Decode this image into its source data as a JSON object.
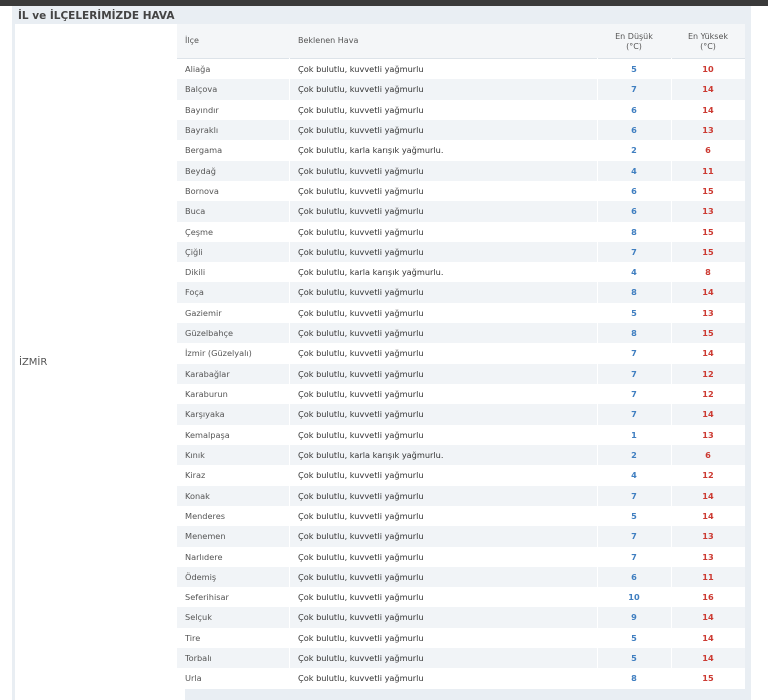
{
  "section": {
    "title": "İL ve İLÇELERİMİZDE HAVA",
    "province": "İZMİR"
  },
  "table": {
    "headers": {
      "district": "İlçe",
      "weather": "Beklenen Hava",
      "min": "En Düşük",
      "min_unit": "(°C)",
      "max": "En Yüksek",
      "max_unit": "(°C)"
    },
    "rows": [
      {
        "district": "Aliağa",
        "weather": "Çok bulutlu, kuvvetli yağmurlu",
        "min": "5",
        "max": "10"
      },
      {
        "district": "Balçova",
        "weather": "Çok bulutlu, kuvvetli yağmurlu",
        "min": "7",
        "max": "14"
      },
      {
        "district": "Bayındır",
        "weather": "Çok bulutlu, kuvvetli yağmurlu",
        "min": "6",
        "max": "14"
      },
      {
        "district": "Bayraklı",
        "weather": "Çok bulutlu, kuvvetli yağmurlu",
        "min": "6",
        "max": "13"
      },
      {
        "district": "Bergama",
        "weather": "Çok bulutlu, karla karışık yağmurlu.",
        "min": "2",
        "max": "6"
      },
      {
        "district": "Beydağ",
        "weather": "Çok bulutlu, kuvvetli yağmurlu",
        "min": "4",
        "max": "11"
      },
      {
        "district": "Bornova",
        "weather": "Çok bulutlu, kuvvetli yağmurlu",
        "min": "6",
        "max": "15"
      },
      {
        "district": "Buca",
        "weather": "Çok bulutlu, kuvvetli yağmurlu",
        "min": "6",
        "max": "13"
      },
      {
        "district": "Çeşme",
        "weather": "Çok bulutlu, kuvvetli yağmurlu",
        "min": "8",
        "max": "15"
      },
      {
        "district": "Çiğli",
        "weather": "Çok bulutlu, kuvvetli yağmurlu",
        "min": "7",
        "max": "15"
      },
      {
        "district": "Dikili",
        "weather": "Çok bulutlu, karla karışık yağmurlu.",
        "min": "4",
        "max": "8"
      },
      {
        "district": "Foça",
        "weather": "Çok bulutlu, kuvvetli yağmurlu",
        "min": "8",
        "max": "14"
      },
      {
        "district": "Gaziemir",
        "weather": "Çok bulutlu, kuvvetli yağmurlu",
        "min": "5",
        "max": "13"
      },
      {
        "district": "Güzelbahçe",
        "weather": "Çok bulutlu, kuvvetli yağmurlu",
        "min": "8",
        "max": "15"
      },
      {
        "district": "İzmir (Güzelyalı)",
        "weather": "Çok bulutlu, kuvvetli yağmurlu",
        "min": "7",
        "max": "14"
      },
      {
        "district": "Karabağlar",
        "weather": "Çok bulutlu, kuvvetli yağmurlu",
        "min": "7",
        "max": "12"
      },
      {
        "district": "Karaburun",
        "weather": "Çok bulutlu, kuvvetli yağmurlu",
        "min": "7",
        "max": "12"
      },
      {
        "district": "Karşıyaka",
        "weather": "Çok bulutlu, kuvvetli yağmurlu",
        "min": "7",
        "max": "14"
      },
      {
        "district": "Kemalpaşa",
        "weather": "Çok bulutlu, kuvvetli yağmurlu",
        "min": "1",
        "max": "13"
      },
      {
        "district": "Kınık",
        "weather": "Çok bulutlu, karla karışık yağmurlu.",
        "min": "2",
        "max": "6"
      },
      {
        "district": "Kiraz",
        "weather": "Çok bulutlu, kuvvetli yağmurlu",
        "min": "4",
        "max": "12"
      },
      {
        "district": "Konak",
        "weather": "Çok bulutlu, kuvvetli yağmurlu",
        "min": "7",
        "max": "14"
      },
      {
        "district": "Menderes",
        "weather": "Çok bulutlu, kuvvetli yağmurlu",
        "min": "5",
        "max": "14"
      },
      {
        "district": "Menemen",
        "weather": "Çok bulutlu, kuvvetli yağmurlu",
        "min": "7",
        "max": "13"
      },
      {
        "district": "Narlıdere",
        "weather": "Çok bulutlu, kuvvetli yağmurlu",
        "min": "7",
        "max": "13"
      },
      {
        "district": "Ödemiş",
        "weather": "Çok bulutlu, kuvvetli yağmurlu",
        "min": "6",
        "max": "11"
      },
      {
        "district": "Seferihisar",
        "weather": "Çok bulutlu, kuvvetli yağmurlu",
        "min": "10",
        "max": "16"
      },
      {
        "district": "Selçuk",
        "weather": "Çok bulutlu, kuvvetli yağmurlu",
        "min": "9",
        "max": "14"
      },
      {
        "district": "Tire",
        "weather": "Çok bulutlu, kuvvetli yağmurlu",
        "min": "5",
        "max": "14"
      },
      {
        "district": "Torbalı",
        "weather": "Çok bulutlu, kuvvetli yağmurlu",
        "min": "5",
        "max": "14"
      },
      {
        "district": "Urla",
        "weather": "Çok bulutlu, kuvvetli yağmurlu",
        "min": "8",
        "max": "15"
      }
    ]
  },
  "colors": {
    "min_temp": "#3f7ec0",
    "max_temp": "#cc3a32",
    "section_bg": "#e9eef3"
  }
}
